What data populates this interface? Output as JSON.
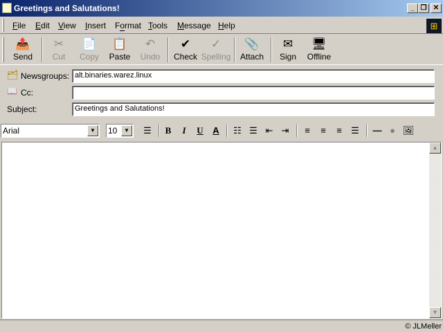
{
  "window": {
    "title": "Greetings and Salutations!",
    "minimize": "_",
    "restore": "❐",
    "close": "✕"
  },
  "menu": [
    "File",
    "Edit",
    "View",
    "Insert",
    "Format",
    "Tools",
    "Message",
    "Help"
  ],
  "menu_access": [
    "F",
    "E",
    "V",
    "I",
    "o",
    "T",
    "M",
    "H"
  ],
  "toolbar": [
    {
      "label": "Send",
      "icon": "📤",
      "enabled": true
    },
    {
      "label": "Cut",
      "icon": "✂",
      "enabled": false
    },
    {
      "label": "Copy",
      "icon": "📄",
      "enabled": false
    },
    {
      "label": "Paste",
      "icon": "📋",
      "enabled": true
    },
    {
      "label": "Undo",
      "icon": "↶",
      "enabled": false
    },
    {
      "label": "Check",
      "icon": "✔",
      "enabled": true
    },
    {
      "label": "Spelling",
      "icon": "✓",
      "enabled": false
    },
    {
      "label": "Attach",
      "icon": "📎",
      "enabled": true
    },
    {
      "label": "Sign",
      "icon": "✉",
      "enabled": true
    },
    {
      "label": "Offline",
      "icon": "🖥",
      "enabled": true
    }
  ],
  "fields": {
    "newsgroups_label": "Newsgroups:",
    "newsgroups_value": "alt.binaries.warez.linux",
    "cc_label": "Cc:",
    "cc_value": "",
    "subject_label": "Subject:",
    "subject_value": "Greetings and Salutations!"
  },
  "format": {
    "font": "Arial",
    "size": "10",
    "bold": "B",
    "italic": "I",
    "underline": "U",
    "color": "A"
  },
  "body": {
    "text": ""
  },
  "status": {
    "text": "© JLMeller"
  }
}
